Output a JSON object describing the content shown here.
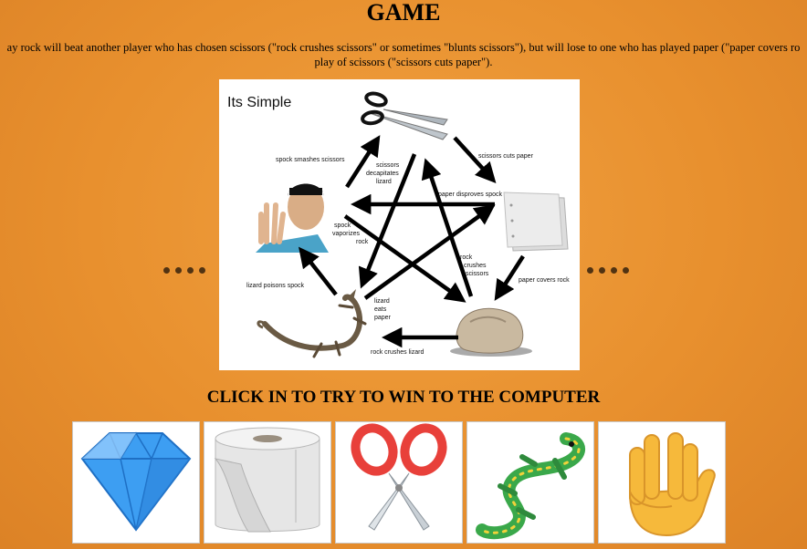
{
  "page": {
    "title": "GAME",
    "description_line1": "ay rock will beat another player who has chosen scissors (\"rock crushes scissors\" or sometimes \"blunts scissors\"), but will lose to one who has played paper (\"paper covers ro",
    "description_line2": "play of scissors (\"scissors cuts paper\").",
    "cta": "CLICK IN TO TRY TO WIN TO THE COMPUTER"
  },
  "diagram": {
    "heading": "Its Simple",
    "labels": {
      "spock_smashes_scissors": "spock smashes scissors",
      "scissors_decapitates_1": "scissors",
      "scissors_decapitates_2": "decapitates",
      "scissors_decapitates_3": "lizard",
      "scissors_cuts_paper": "scissors cuts paper",
      "paper_disproves_spock": "paper disproves spock",
      "spock_vaporizes_1": "spock",
      "spock_vaporizes_2": "vaporizes",
      "spock_vaporizes_3": "rock",
      "rock_crushes_1": "rock",
      "rock_crushes_2": "crushes",
      "rock_crushes_3": "scissors",
      "lizard_poisons_spock": "lizard poisons spock",
      "paper_covers_rock": "paper covers rock",
      "lizard_eats_1": "lizard",
      "lizard_eats_2": "eats",
      "lizard_eats_3": "paper",
      "rock_crushes_lizard": "rock crushes lizard"
    }
  },
  "choices": [
    {
      "id": "rock",
      "icon": "gem-icon"
    },
    {
      "id": "paper",
      "icon": "toilet-paper-icon"
    },
    {
      "id": "scissors",
      "icon": "scissors-icon"
    },
    {
      "id": "lizard",
      "icon": "lizard-icon"
    },
    {
      "id": "spock",
      "icon": "vulcan-salute-icon"
    }
  ],
  "colors": {
    "background": "#e8902e",
    "gem": "#3a9ef0",
    "scissors_handle": "#e8403a",
    "lizard": "#3aa84a",
    "hand": "#f6b93b"
  }
}
